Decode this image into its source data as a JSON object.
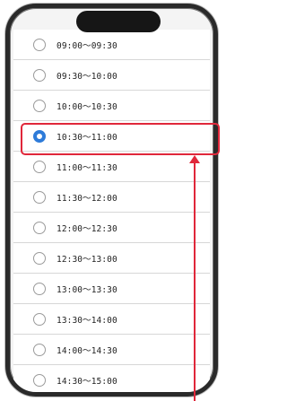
{
  "time_slots": [
    {
      "label": "09:00～09:30",
      "selected": false
    },
    {
      "label": "09:30～10:00",
      "selected": false
    },
    {
      "label": "10:00～10:30",
      "selected": false
    },
    {
      "label": "10:30～11:00",
      "selected": true
    },
    {
      "label": "11:00～11:30",
      "selected": false
    },
    {
      "label": "11:30～12:00",
      "selected": false
    },
    {
      "label": "12:00～12:30",
      "selected": false
    },
    {
      "label": "12:30～13:00",
      "selected": false
    },
    {
      "label": "13:00～13:30",
      "selected": false
    },
    {
      "label": "13:30～14:00",
      "selected": false
    },
    {
      "label": "14:00～14:30",
      "selected": false
    },
    {
      "label": "14:30～15:00",
      "selected": false
    }
  ],
  "colors": {
    "accent": "#2e7bd9",
    "annotation": "#e0273a"
  }
}
